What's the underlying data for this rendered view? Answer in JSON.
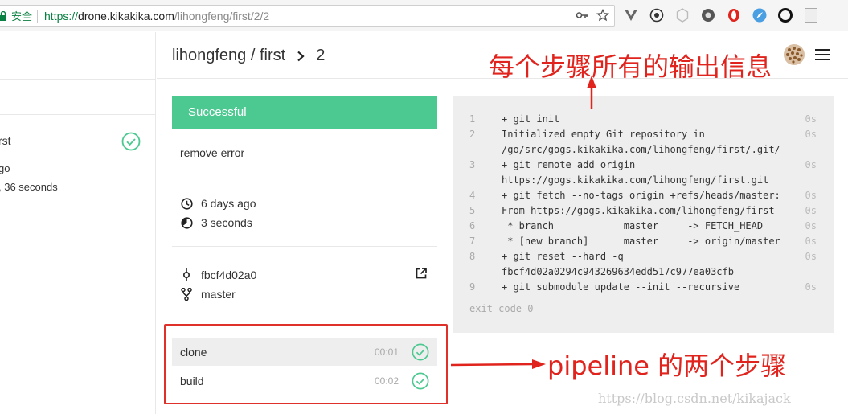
{
  "browser": {
    "secure_label": "安全",
    "url_scheme": "https://",
    "url_host": "drone.kikakika.com",
    "url_path": "/lihongfeng/first/2/2"
  },
  "sidebar": {
    "build_name": "rst",
    "build_ago": "go",
    "build_duration": ", 36 seconds"
  },
  "header": {
    "repo": "lihongfeng / first",
    "build_number": "2"
  },
  "build": {
    "status": "Successful",
    "message": "remove error",
    "created": "6 days ago",
    "duration": "3 seconds",
    "commit": "fbcf4d02a0",
    "branch": "master"
  },
  "steps": [
    {
      "name": "clone",
      "time": "00:01",
      "active": true
    },
    {
      "name": "build",
      "time": "00:02",
      "active": false
    }
  ],
  "log": {
    "lines": [
      {
        "num": "1",
        "text": "+ git init",
        "time": "0s"
      },
      {
        "num": "2",
        "text": "Initialized empty Git repository in",
        "time": "0s"
      },
      {
        "num": "",
        "text": "/go/src/gogs.kikakika.com/lihongfeng/first/.git/",
        "time": ""
      },
      {
        "num": "3",
        "text": "+ git remote add origin",
        "time": "0s"
      },
      {
        "num": "",
        "text": "https://gogs.kikakika.com/lihongfeng/first.git",
        "time": ""
      },
      {
        "num": "4",
        "text": "+ git fetch --no-tags origin +refs/heads/master:",
        "time": "0s"
      },
      {
        "num": "5",
        "text": "From https://gogs.kikakika.com/lihongfeng/first",
        "time": "0s"
      },
      {
        "num": "6",
        "text": " * branch            master     -> FETCH_HEAD",
        "time": "0s"
      },
      {
        "num": "7",
        "text": " * [new branch]      master     -> origin/master",
        "time": "0s"
      },
      {
        "num": "8",
        "text": "+ git reset --hard -q",
        "time": "0s"
      },
      {
        "num": "",
        "text": "fbcf4d02a0294c943269634edd517c977ea03cfb",
        "time": ""
      },
      {
        "num": "9",
        "text": "+ git submodule update --init --recursive",
        "time": "0s"
      }
    ],
    "exit_code": "exit code 0"
  },
  "annotations": {
    "top": "每个步骤所有的输出信息",
    "bottom": "pipeline 的两个步骤"
  },
  "watermark": "https://blog.csdn.net/kikajack",
  "colors": {
    "success": "#4cc891",
    "annotation_red": "#e0241d",
    "url_green": "#0b8043"
  }
}
